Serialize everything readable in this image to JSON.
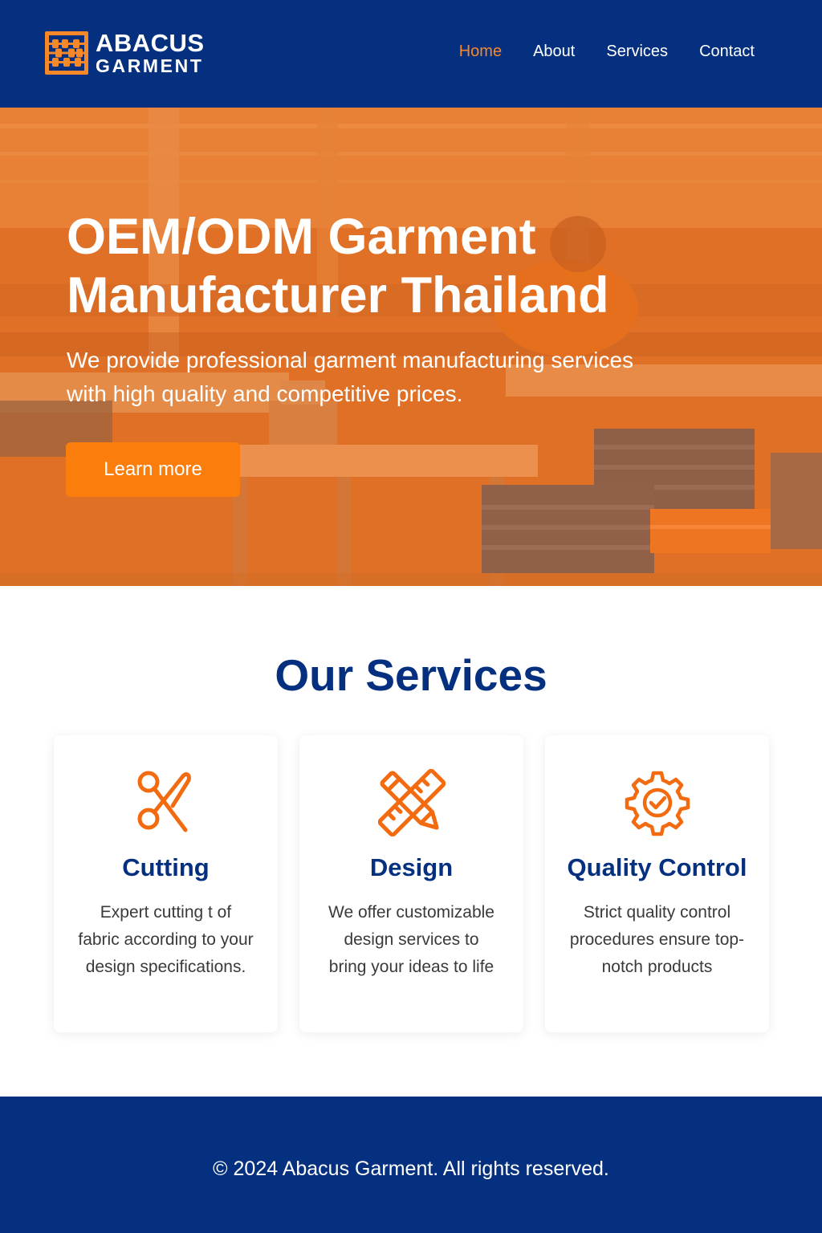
{
  "brand": {
    "name_line1": "ABACUS",
    "name_line2": "GARMENT",
    "primary_color": "#04307f",
    "accent_color": "#fb7d0c",
    "logo_icon": "abacus-icon"
  },
  "nav": {
    "items": [
      {
        "label": "Home",
        "active": true
      },
      {
        "label": "About",
        "active": false
      },
      {
        "label": "Services",
        "active": false
      },
      {
        "label": "Contact",
        "active": false
      }
    ]
  },
  "hero": {
    "title": "OEM/ODM Garment Manufacturer Thailand",
    "subtitle": "We provide professional garment manufacturing services with high quality and competitive prices.",
    "cta_label": "Learn more"
  },
  "services": {
    "heading": "Our Services",
    "cards": [
      {
        "icon": "scissors-icon",
        "title": "Cutting",
        "text": "Expert cutting t of fabric according to your design specifications."
      },
      {
        "icon": "pencil-ruler-icon",
        "title": "Design",
        "text": "We offer customizable design services to bring your ideas to life"
      },
      {
        "icon": "gear-check-icon",
        "title": "Quality Control",
        "text": "Strict quality control procedures ensure top-notch products"
      }
    ]
  },
  "footer": {
    "copyright": "© 2024 Abacus Garment. All rights reserved."
  }
}
